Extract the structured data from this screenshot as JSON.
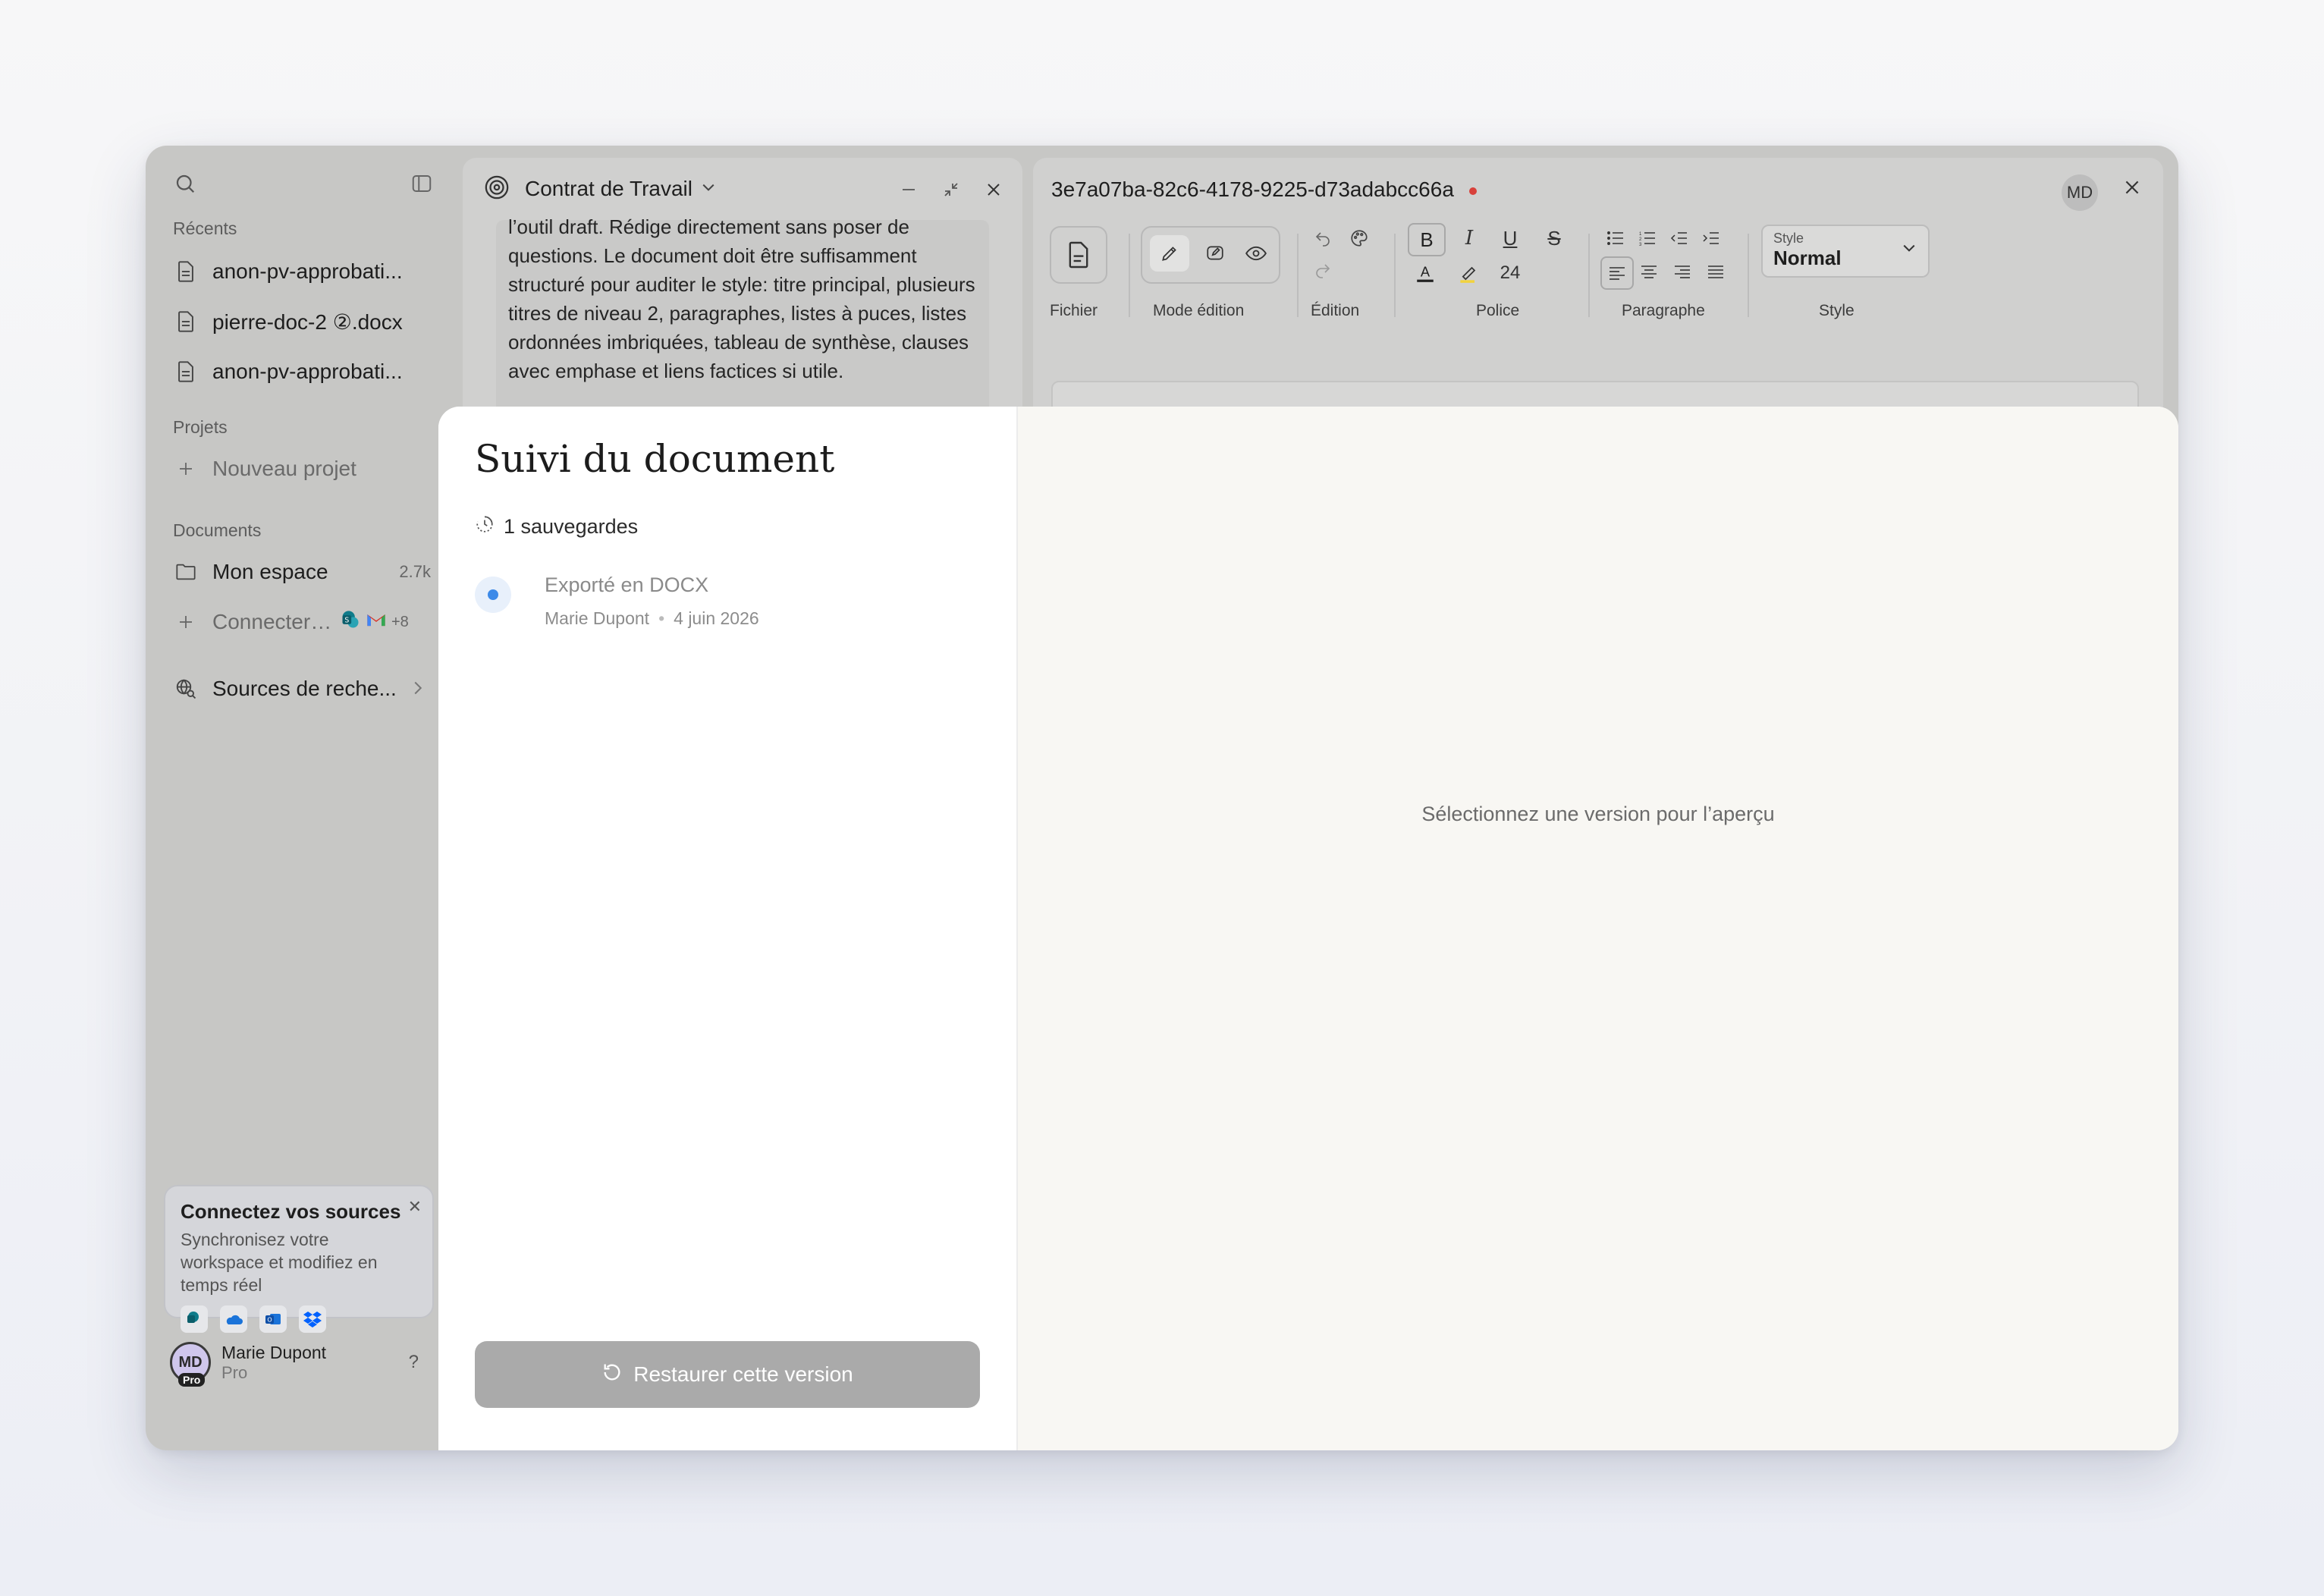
{
  "sidebar": {
    "recents_label": "Récents",
    "recents": [
      {
        "label": "anon-pv-approbati..."
      },
      {
        "label": "pierre-doc-2 ②.docx"
      },
      {
        "label": "anon-pv-approbati..."
      }
    ],
    "projects_label": "Projets",
    "new_project": "Nouveau projet",
    "documents_label": "Documents",
    "my_space": "Mon espace",
    "my_space_count": "2.7k",
    "connect": "Connecter ...",
    "connect_more": "+8",
    "research_sources": "Sources de reche...",
    "connect_card": {
      "title": "Connectez vos sources",
      "description": "Synchronisez votre workspace et modifiez en temps réel"
    },
    "user": {
      "initials": "MD",
      "badge": "Pro",
      "name": "Marie Dupont",
      "plan": "Pro",
      "help": "?"
    }
  },
  "chat": {
    "title": "Contrat de Travail",
    "body": "l’outil draft. Rédige directement sans poser de questions. Le document doit être suffisamment structuré pour auditer le style: titre principal, plusieurs titres de niveau 2, paragraphes, listes à puces, listes ordonnées imbriquées, tableau de synthèse, clauses avec emphase et liens factices si utile."
  },
  "editor": {
    "doc_id": "3e7a07ba-82c6-4178-9225-d73adabcc66a",
    "user_initials": "MD",
    "groups": {
      "file": "Fichier",
      "edit_mode": "Mode édition",
      "editing": "Édition",
      "font": "Police",
      "paragraph": "Paragraphe",
      "style": "Style"
    },
    "font_size": "24",
    "style_select": {
      "label": "Style",
      "value": "Normal"
    }
  },
  "modal": {
    "title": "Suivi du document",
    "saves_count": "1 sauvegardes",
    "versions": [
      {
        "action": "Exporté en DOCX",
        "author": "Marie Dupont",
        "date": "4 juin 2026"
      }
    ],
    "restore_label": "Restaurer cette version",
    "preview_placeholder": "Sélectionnez une version pour l’aperçu"
  },
  "colors": {
    "accent_blue": "#3d8ae8",
    "unsaved_dot": "#d8413b",
    "restore_disabled": "#aaaaaa"
  }
}
